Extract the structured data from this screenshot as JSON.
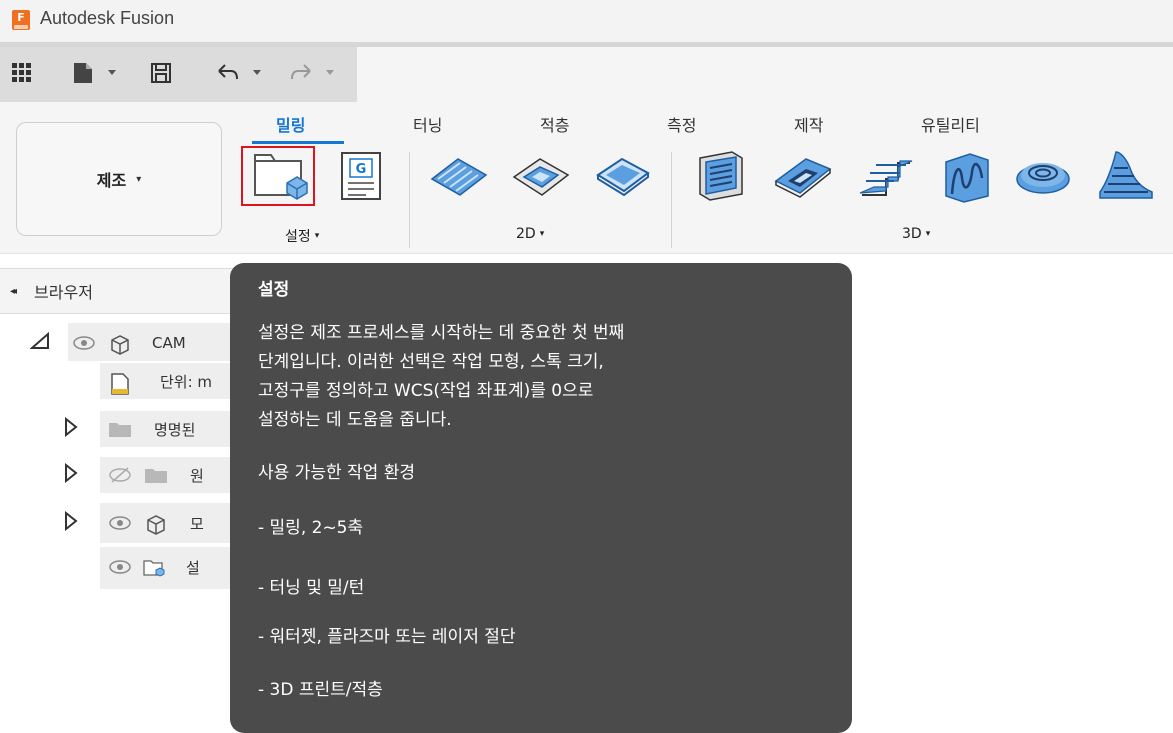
{
  "window": {
    "title": "Autodesk Fusion",
    "logo_letter": "F"
  },
  "ribbon": {
    "workspace": {
      "label": "제조",
      "caret": "▾"
    },
    "tabs": [
      {
        "label": "밀링",
        "active": true
      },
      {
        "label": "터닝",
        "active": false
      },
      {
        "label": "적층",
        "active": false
      },
      {
        "label": "측정",
        "active": false
      },
      {
        "label": "제작",
        "active": false
      },
      {
        "label": "유틸리티",
        "active": false
      }
    ],
    "groups": {
      "setup": {
        "label": "설정",
        "caret": "▾"
      },
      "two_d": {
        "label": "2D",
        "caret": "▾"
      },
      "three_d": {
        "label": "3D",
        "caret": "▾"
      }
    },
    "nc_program_letter": "G"
  },
  "browser": {
    "header": "브라우저",
    "collapse_glyph": "◂◂",
    "rows": [
      {
        "label": "CAM"
      },
      {
        "label": "단위: m"
      },
      {
        "label": "명명된"
      },
      {
        "label": "원"
      },
      {
        "label": "모"
      },
      {
        "label": "설"
      }
    ]
  },
  "tooltip": {
    "title": "설정",
    "body_lines": [
      "설정은 제조 프로세스를 시작하는 데 중요한 첫 번째",
      "단계입니다. 이러한 선택은 작업 모형, 스톡 크기,",
      "고정구를 정의하고 WCS(작업 좌표계)를 0으로",
      "설정하는 데 도움을 줍니다."
    ],
    "subtitle": "사용 가능한 작업 환경",
    "items": [
      "- 밀링, 2~5축",
      "- 터닝 및 밀/턴",
      "- 워터젯, 플라즈마 또는 레이저 절단",
      "- 3D 프린트/적층"
    ]
  },
  "colors": {
    "accent": "#1477d3",
    "selection": "#e0141e",
    "tooltip_bg": "#4b4b4b",
    "brand": "#f26f21"
  }
}
